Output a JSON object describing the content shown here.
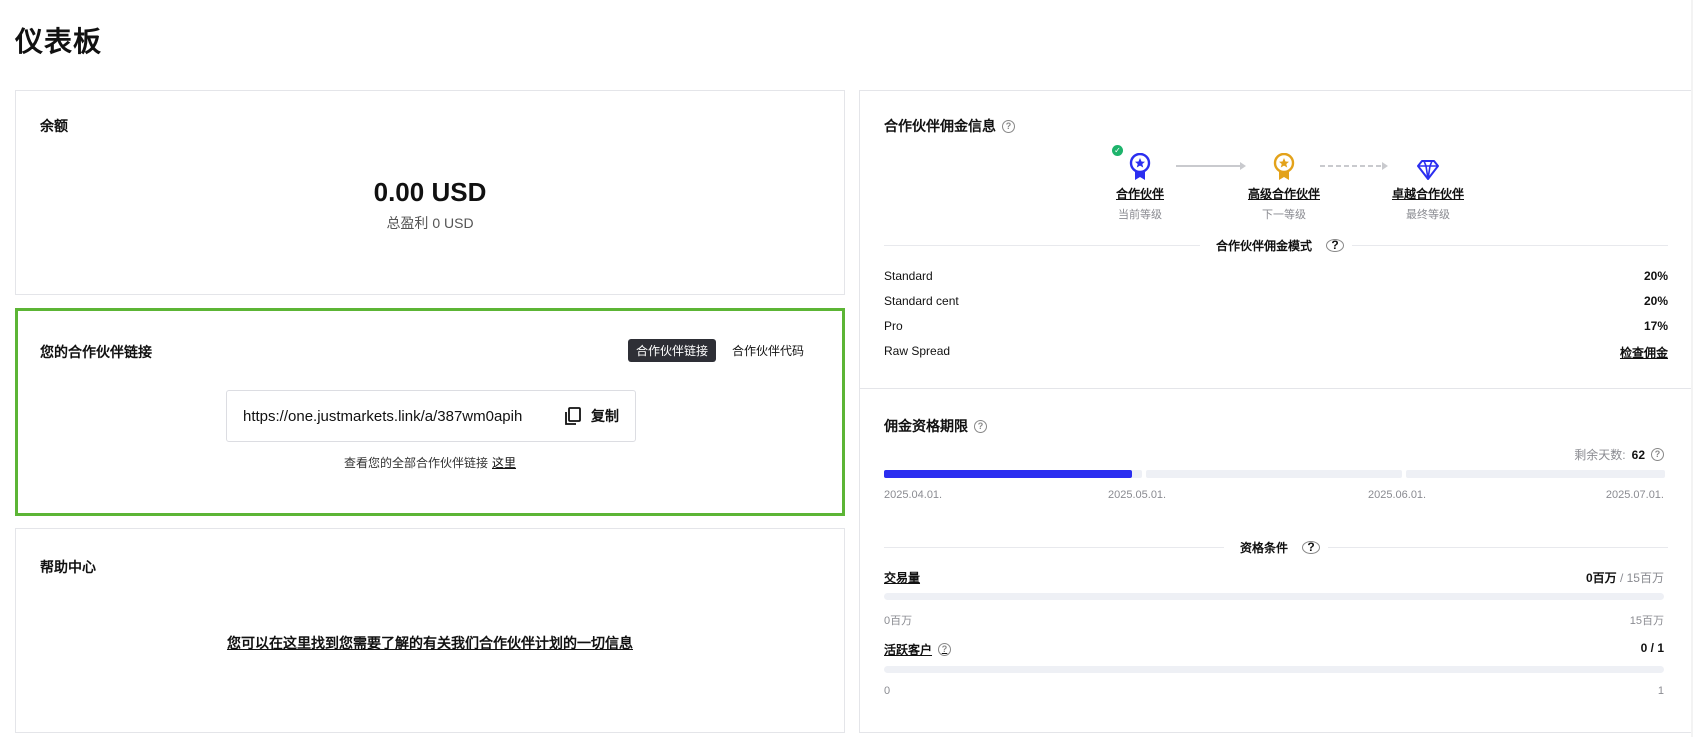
{
  "page": {
    "title": "仪表板"
  },
  "balance": {
    "title": "余额",
    "amount": "0.00 USD",
    "profit": "总盈利 0 USD"
  },
  "partner_link": {
    "title": "您的合作伙伴链接",
    "tabs": [
      "合作伙伴链接",
      "合作伙伴代码"
    ],
    "url": "https://one.justmarkets.link/a/387wm0apih",
    "copy_label": "复制",
    "hint": "查看您的全部合作伙伴链接",
    "hint_link": "这里"
  },
  "help_center": {
    "title": "帮助中心",
    "link": "您可以在这里找到您需要了解的有关我们合作伙伴计划的一切信息"
  },
  "commission": {
    "title": "合作伙伴佣金信息",
    "tiers": [
      {
        "name": "合作伙伴",
        "sub": "当前等级",
        "icon": "ribbon-medal-icon",
        "color": "#2b2ef0"
      },
      {
        "name": "高级合作伙伴",
        "sub": "下一等级",
        "icon": "gold-medal-icon",
        "color": "#e3a21a"
      },
      {
        "name": "卓越合作伙伴",
        "sub": "最终等级",
        "icon": "diamond-icon",
        "color": "#2b2ef0"
      }
    ],
    "model_label": "合作伙伴佣金模式",
    "rates": [
      {
        "name": "Standard",
        "value": "20%"
      },
      {
        "name": "Standard cent",
        "value": "20%"
      },
      {
        "name": "Pro",
        "value": "17%"
      },
      {
        "name": "Raw Spread",
        "value": "检查佣金"
      }
    ]
  },
  "qualification": {
    "title": "佣金资格期限",
    "remaining_label": "剩余天数:",
    "remaining_days": "62",
    "dates": [
      "2025.04.01.",
      "2025.05.01.",
      "2025.06.01.",
      "2025.07.01."
    ],
    "first_segment_progress": 0.96,
    "conditions_label": "资格条件",
    "volume": {
      "name": "交易量",
      "current": "0百万",
      "target": "/ 15百万",
      "min": "0百万",
      "max": "15百万",
      "progress": 0
    },
    "clients": {
      "name": "活跃客户",
      "current": "0 / 1",
      "min": "0",
      "max": "1",
      "progress": 0
    }
  }
}
